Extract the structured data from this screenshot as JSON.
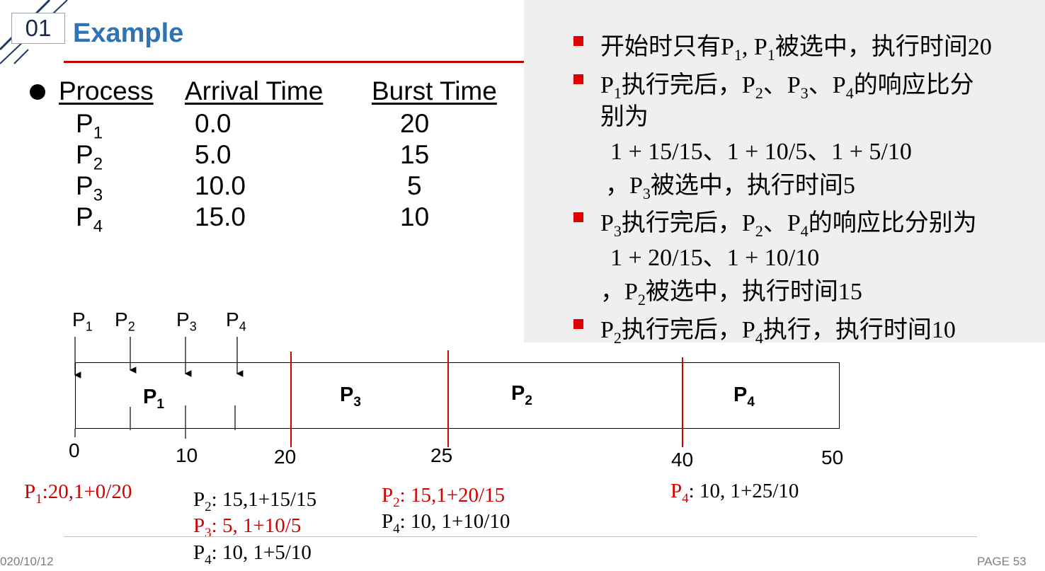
{
  "slide": {
    "number": "01",
    "title": "Example",
    "date": "020/10/12",
    "page": "PAGE 53"
  },
  "table": {
    "headers": [
      "Process",
      "Arrival Time",
      "Burst Time"
    ],
    "rows": [
      {
        "p": "P",
        "sub": "1",
        "arrival": "0.0",
        "burst": "20"
      },
      {
        "p": "P",
        "sub": "2",
        "arrival": "5.0",
        "burst": "15"
      },
      {
        "p": "P",
        "sub": "3",
        "arrival": "10.0",
        "burst": "5"
      },
      {
        "p": "P",
        "sub": "4",
        "arrival": "15.0",
        "burst": "10"
      }
    ]
  },
  "panel": {
    "b1": {
      "t1": "开始时只有P",
      "s1": "1",
      "t2": ", P",
      "s2": "1",
      "t3": "被选中，执行时间20"
    },
    "b2": {
      "t1": "P",
      "s1": "1",
      "t2": "执行完后，P",
      "s2": "2",
      "t3": "、P",
      "s3": "3",
      "t4": "、P",
      "s4": "4",
      "t5": "的响应比分",
      "line2": "别为",
      "ratios": "1 + 15/15、1 + 10/5、1 + 5/10",
      "sel_a": "，P",
      "sel_s": "3",
      "sel_b": "被选中，执行时间5"
    },
    "b3": {
      "t1": "P",
      "s1": "3",
      "t2": "执行完后，P",
      "s2": "2",
      "t3": "、P",
      "s3": "4",
      "t4": "的响应比分别为",
      "ratios": "1 + 20/15、1 + 10/10",
      "sel_a": "，P",
      "sel_s": "2",
      "sel_b": "被选中，执行时间15"
    },
    "b4": {
      "t1": "P",
      "s1": "2",
      "t2": "执行完后，P",
      "s2": "4",
      "t3": "执行，执行时间10"
    }
  },
  "gantt": {
    "arrivals": [
      {
        "p": "P",
        "sub": "1"
      },
      {
        "p": "P",
        "sub": "2"
      },
      {
        "p": "P",
        "sub": "3"
      },
      {
        "p": "P",
        "sub": "4"
      }
    ],
    "blocks": [
      {
        "p": "P",
        "sub": "1"
      },
      {
        "p": "P",
        "sub": "3"
      },
      {
        "p": "P",
        "sub": "2"
      },
      {
        "p": "P",
        "sub": "4"
      }
    ],
    "ticks": [
      "0",
      "10",
      "20",
      "25",
      "40",
      "50"
    ],
    "colors": {
      "marker": "#d40000",
      "note_red": "#d40000",
      "accent": "#2e74b5"
    }
  },
  "notes": {
    "n1": {
      "p": "P",
      "s": "1",
      "v": ":20,1+0/20"
    },
    "n2a": {
      "p": "P",
      "s": "2",
      "v": ": 15,1+15/15"
    },
    "n2b": {
      "p": "P",
      "s": "3",
      "v": ": 5, 1+10/5"
    },
    "n2c": {
      "p": "P",
      "s": "4",
      "v": ": 10, 1+5/10"
    },
    "n3a": {
      "p": "P",
      "s": "2",
      "v": ": 15,1+20/15"
    },
    "n3b": {
      "p": "P",
      "s": "4",
      "v": ": 10, 1+10/10"
    },
    "n4": {
      "p": "P",
      "s": "4",
      "v": ": 10, 1+25/10"
    }
  }
}
